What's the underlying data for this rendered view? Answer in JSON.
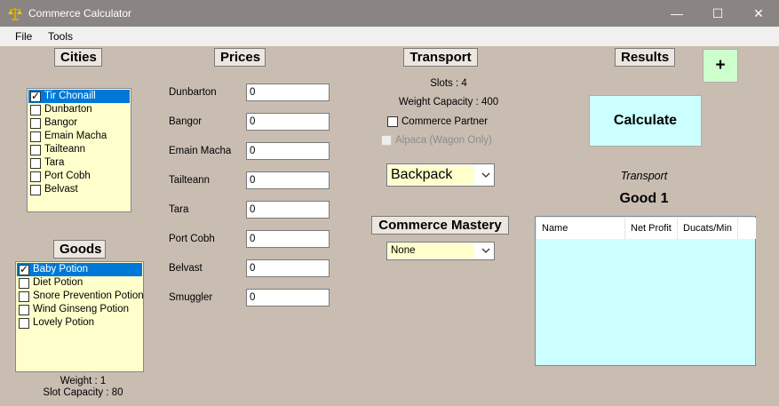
{
  "window": {
    "title": "Commerce Calculator",
    "app_icon": "scales-icon",
    "controls": {
      "minimize": "—",
      "maximize": "☐",
      "close": "✕"
    }
  },
  "menu": {
    "file": "File",
    "tools": "Tools"
  },
  "cities": {
    "heading": "Cities",
    "items": [
      {
        "label": "Tir Chonaill",
        "checked": true,
        "selected": true
      },
      {
        "label": "Dunbarton",
        "checked": false,
        "selected": false
      },
      {
        "label": "Bangor",
        "checked": false,
        "selected": false
      },
      {
        "label": "Emain Macha",
        "checked": false,
        "selected": false
      },
      {
        "label": "Tailteann",
        "checked": false,
        "selected": false
      },
      {
        "label": "Tara",
        "checked": false,
        "selected": false
      },
      {
        "label": "Port Cobh",
        "checked": false,
        "selected": false
      },
      {
        "label": "Belvast",
        "checked": false,
        "selected": false
      }
    ]
  },
  "goods": {
    "heading": "Goods",
    "items": [
      {
        "label": "Baby Potion",
        "checked": true,
        "selected": true
      },
      {
        "label": "Diet Potion",
        "checked": false,
        "selected": false
      },
      {
        "label": "Snore Prevention Potion",
        "checked": false,
        "selected": false
      },
      {
        "label": "Wind Ginseng Potion",
        "checked": false,
        "selected": false
      },
      {
        "label": "Lovely Potion",
        "checked": false,
        "selected": false
      }
    ],
    "weight": "Weight : 1",
    "slot_capacity": "Slot Capacity : 80"
  },
  "prices": {
    "heading": "Prices",
    "rows": [
      {
        "label": "Dunbarton",
        "value": "0"
      },
      {
        "label": "Bangor",
        "value": "0"
      },
      {
        "label": "Emain Macha",
        "value": "0"
      },
      {
        "label": "Tailteann",
        "value": "0"
      },
      {
        "label": "Tara",
        "value": "0"
      },
      {
        "label": "Port Cobh",
        "value": "0"
      },
      {
        "label": "Belvast",
        "value": "0"
      },
      {
        "label": "Smuggler",
        "value": "0"
      }
    ]
  },
  "transport": {
    "heading": "Transport",
    "slots": "Slots : 4",
    "weight_capacity": "Weight Capacity : 400",
    "commerce_partner": {
      "label": "Commerce Partner",
      "checked": false
    },
    "alpaca": {
      "label": "Alpaca (Wagon Only)",
      "checked": false,
      "enabled": false
    },
    "selected": "Backpack"
  },
  "mastery": {
    "heading": "Commerce Mastery",
    "selected": "None"
  },
  "results": {
    "heading": "Results",
    "add_button": "+",
    "calculate_button": "Calculate",
    "transport_label": "Transport",
    "good_label": "Good 1",
    "columns": [
      "Name",
      "Net Profit",
      "Ducats/Min"
    ]
  },
  "colors": {
    "list_background": "#ffffcc",
    "selection": "#0078d7",
    "calculate_background": "#ccffff",
    "add_background": "#ccffcc",
    "client_background": "#c9bdb2"
  }
}
